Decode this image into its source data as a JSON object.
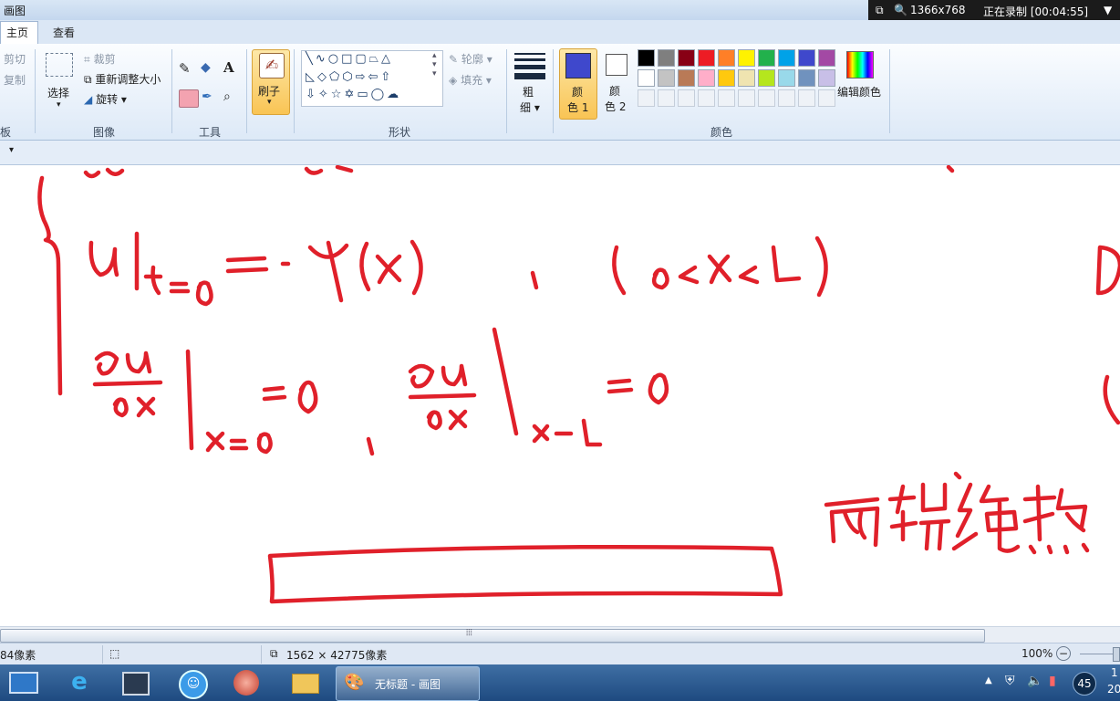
{
  "window": {
    "title": "画图"
  },
  "recorder": {
    "resolution": "1366x768",
    "status": "正在录制 [00:04:55]"
  },
  "tabs": [
    {
      "label": "主页"
    },
    {
      "label": "查看"
    }
  ],
  "ribbon": {
    "clipboard": {
      "cut": "剪切",
      "copy": "复制",
      "label_partial": "板"
    },
    "image": {
      "select": "选择",
      "crop": "裁剪",
      "resize": "重新调整大小",
      "rotate": "旋转",
      "label": "图像"
    },
    "tools": {
      "label": "工具"
    },
    "brush": {
      "label": "刷子"
    },
    "shapes": {
      "outline": "轮廓",
      "fill": "填充",
      "label": "形状"
    },
    "size": {
      "label_line1": "粗",
      "label_line2": "细"
    },
    "color1": {
      "line1": "颜",
      "line2": "色 1"
    },
    "color2": {
      "line1": "颜",
      "line2": "色 2"
    },
    "edit_colors": "编辑颜色",
    "colors_label": "颜色",
    "palette_row1": [
      "#000000",
      "#7f7f7f",
      "#880015",
      "#ed1c24",
      "#ff7f27",
      "#fff200",
      "#22b14c",
      "#00a2e8",
      "#3f48cc",
      "#a349a4"
    ],
    "palette_row2": [
      "#ffffff",
      "#c3c3c3",
      "#b97a57",
      "#ffaec9",
      "#ffc90e",
      "#efe4b0",
      "#b5e61d",
      "#99d9ea",
      "#7092be",
      "#c8bfe7"
    ],
    "color1_value": "#3f48cc",
    "ink_color": "#e0202a"
  },
  "canvas": {
    "handwriting": {
      "line1": "u|t=0 = φ(x) , ( 0<x<L )",
      "line2": "∂u/∂x |x=0 = 0 , ∂u/∂x |x=L = 0",
      "note": "两端绝热"
    }
  },
  "status": {
    "cursor_pos": "84像素",
    "canvas_size": "1562 × 42775像素",
    "zoom": "100%"
  },
  "taskbar": {
    "active_task": "无标题 - 画图",
    "clock_top": "1",
    "clock_bottom": "20",
    "badge": "45"
  }
}
